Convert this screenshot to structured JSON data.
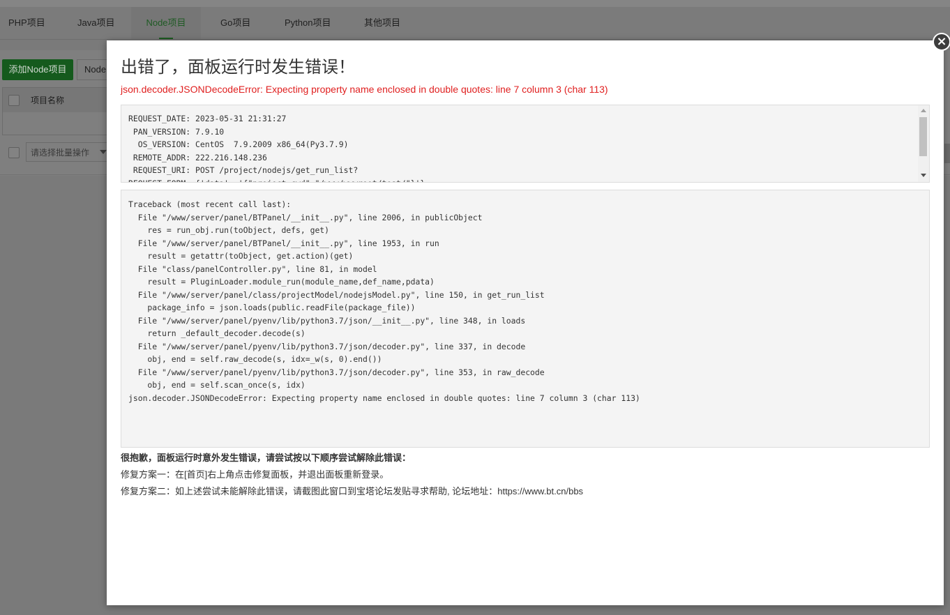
{
  "tabs": [
    {
      "label": "PHP项目"
    },
    {
      "label": "Java项目"
    },
    {
      "label": "Node项目"
    },
    {
      "label": "Go项目"
    },
    {
      "label": "Python项目"
    },
    {
      "label": "其他项目"
    }
  ],
  "toolbar": {
    "add_node_label": "添加Node项目",
    "node_label": "Node"
  },
  "table": {
    "col_name": "项目名称"
  },
  "batch": {
    "placeholder": "请选择批量操作"
  },
  "modal": {
    "title": "出错了，面板运行时发生错误！",
    "error_summary": "json.decoder.JSONDecodeError: Expecting property name enclosed in double quotes: line 7 column 3 (char 113)",
    "request_info": "REQUEST_DATE: 2023-05-31 21:31:27\n PAN_VERSION: 7.9.10\n  OS_VERSION: CentOS  7.9.2009 x86_64(Py3.7.9)\n REMOTE_ADDR: 222.216.148.236\n REQUEST_URI: POST /project/nodejs/get_run_list?\nREQUEST_FORM: {'data': '{\"project_cwd\":\"/www/wwwroot/test/\"}'}",
    "traceback": "Traceback (most recent call last):\n  File \"/www/server/panel/BTPanel/__init__.py\", line 2006, in publicObject\n    res = run_obj.run(toObject, defs, get)\n  File \"/www/server/panel/BTPanel/__init__.py\", line 1953, in run\n    result = getattr(toObject, get.action)(get)\n  File \"class/panelController.py\", line 81, in model\n    result = PluginLoader.module_run(module_name,def_name,pdata)\n  File \"/www/server/panel/class/projectModel/nodejsModel.py\", line 150, in get_run_list\n    package_info = json.loads(public.readFile(package_file))\n  File \"/www/server/panel/pyenv/lib/python3.7/json/__init__.py\", line 348, in loads\n    return _default_decoder.decode(s)\n  File \"/www/server/panel/pyenv/lib/python3.7/json/decoder.py\", line 337, in decode\n    obj, end = self.raw_decode(s, idx=_w(s, 0).end())\n  File \"/www/server/panel/pyenv/lib/python3.7/json/decoder.py\", line 353, in raw_decode\n    obj, end = self.scan_once(s, idx)\njson.decoder.JSONDecodeError: Expecting property name enclosed in double quotes: line 7 column 3 (char 113)",
    "help_heading": "很抱歉，面板运行时意外发生错误，请尝试按以下顺序尝试解除此错误：",
    "fix_one": "修复方案一：在[首页]右上角点击修复面板，并退出面板重新登录。",
    "fix_two": "修复方案二：如上述尝试未能解除此错误，请截图此窗口到宝塔论坛发贴寻求帮助, 论坛地址：https://www.bt.cn/bbs",
    "close_icon": "close-icon"
  },
  "colors": {
    "error_red": "#e02020",
    "accent_green": "#20a53a",
    "overlay": "#808080"
  }
}
